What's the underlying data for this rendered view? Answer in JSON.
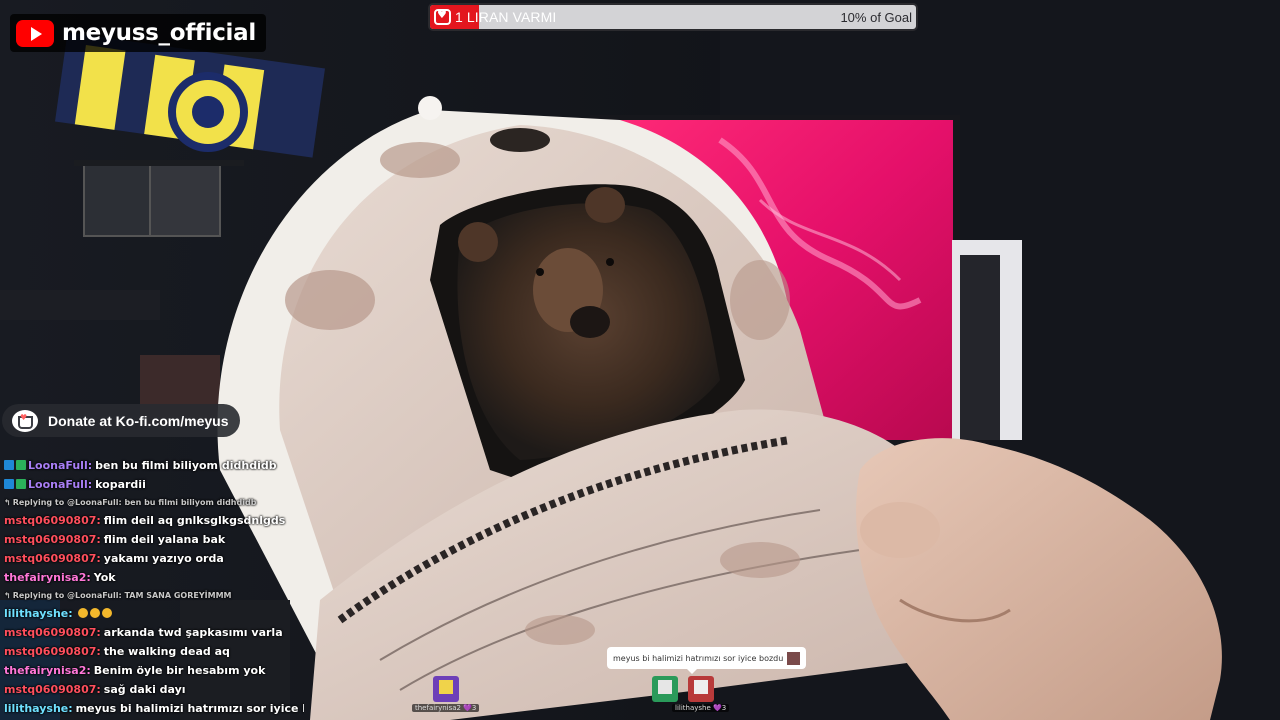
{
  "channel": {
    "name": "meyuss_official",
    "platform_icon": "youtube-icon"
  },
  "goal": {
    "title": "1 LIRAN VARMI",
    "progress_text": "10% of Goal",
    "progress_percent": 10,
    "icon": "heart-icon",
    "accent": "#e3161e"
  },
  "kofi": {
    "text": "Donate at Ko-fi.com/meyus",
    "icon": "kofi-cup-icon"
  },
  "chat": {
    "messages": [
      {
        "type": "msg",
        "badges": [
          "sub",
          "prime"
        ],
        "user": "LoonaFull:",
        "color": "#a97ff6",
        "text": "ben bu filmi biliyom didhdidb"
      },
      {
        "type": "msg",
        "badges": [
          "sub",
          "prime"
        ],
        "user": "LoonaFull:",
        "color": "#a97ff6",
        "text": "kopardii"
      },
      {
        "type": "reply",
        "text": "Replying to @LoonaFull: ben bu filmi biliyom didhdidb"
      },
      {
        "type": "msg",
        "badges": [],
        "user": "mstq06090807:",
        "color": "#ff4f5d",
        "text": "flim deil aq gnlksglkgsdnlgds"
      },
      {
        "type": "msg",
        "badges": [],
        "user": "mstq06090807:",
        "color": "#ff4f5d",
        "text": "flim deil yalana bak"
      },
      {
        "type": "msg",
        "badges": [],
        "user": "mstq06090807:",
        "color": "#ff4f5d",
        "text": "yakamı yazıyo orda"
      },
      {
        "type": "msg",
        "badges": [],
        "user": "thefairynisa2:",
        "color": "#ff77d8",
        "text": "Yok"
      },
      {
        "type": "reply",
        "text": "Replying to @LoonaFull: TAM SANA GOREYİMMM"
      },
      {
        "type": "msg",
        "badges": [],
        "user": "lilithayshe:",
        "color": "#6fe0ff",
        "text": "",
        "emotes": 3
      },
      {
        "type": "msg",
        "badges": [],
        "user": "mstq06090807:",
        "color": "#ff4f5d",
        "text": "arkanda twd şapkasımı varla"
      },
      {
        "type": "msg",
        "badges": [],
        "user": "mstq06090807:",
        "color": "#ff4f5d",
        "text": "the walking dead aq"
      },
      {
        "type": "msg",
        "badges": [],
        "user": "thefairynisa2:",
        "color": "#ff77d8",
        "text": "Benim öyle bir hesabım yok"
      },
      {
        "type": "msg",
        "badges": [],
        "user": "mstq06090807:",
        "color": "#ff4f5d",
        "text": "sağ daki dayı"
      },
      {
        "type": "msg",
        "badges": [],
        "user": "lilithayshe:",
        "color": "#6fe0ff",
        "text": "meyus bi halimizi hatrımızı sor iyice bozdu"
      }
    ]
  },
  "popup": {
    "text": "meyus bi halimizi hatrımızı sor iyice bozdu"
  },
  "avatars": [
    {
      "name": "thefairynisa2 💜3",
      "color": "#6d3fb8"
    },
    {
      "name": "",
      "color": "#2a9a5a"
    },
    {
      "name": "lilithayshe 💜3",
      "color": "#b83a3a"
    }
  ]
}
